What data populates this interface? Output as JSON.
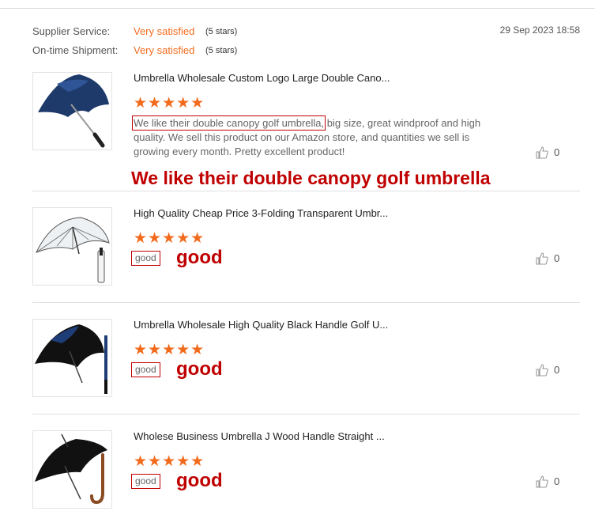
{
  "header": {
    "supplier_label": "Supplier Service:",
    "supplier_value": "Very satisfied",
    "supplier_stars": "(5 stars)",
    "shipment_label": "On-time Shipment:",
    "shipment_value": "Very satisfied",
    "shipment_stars": "(5 stars)",
    "date": "29 Sep 2023 18:58"
  },
  "reviews": [
    {
      "title": "Umbrella Wholesale Custom Logo Large Double Cano...",
      "stars": "★★★★★",
      "rating": 5,
      "highlight": "We like their double canopy golf umbrella,",
      "text_rest": " big size, great windproof and high quality. We sell this product on our Amazon store, and quantities we sell is growing every month. Pretty excellent product!",
      "annotation": "We like their double canopy golf umbrella",
      "likes": "0"
    },
    {
      "title": "High Quality Cheap Price 3-Folding Transparent Umbr...",
      "stars": "★★★★★",
      "rating": 5,
      "text": "good",
      "annotation": "good",
      "likes": "0"
    },
    {
      "title": "Umbrella Wholesale High Quality Black Handle Golf U...",
      "stars": "★★★★★",
      "rating": 5,
      "text": "good",
      "annotation": "good",
      "likes": "0"
    },
    {
      "title": "Wholese Business Umbrella J Wood Handle Straight ...",
      "stars": "★★★★★",
      "rating": 5,
      "text": "good",
      "annotation": "good",
      "likes": "0"
    }
  ],
  "colors": {
    "accent": "#f26b1d",
    "annotation": "#c00000"
  },
  "icons": {
    "like": "thumbs-up-icon"
  }
}
